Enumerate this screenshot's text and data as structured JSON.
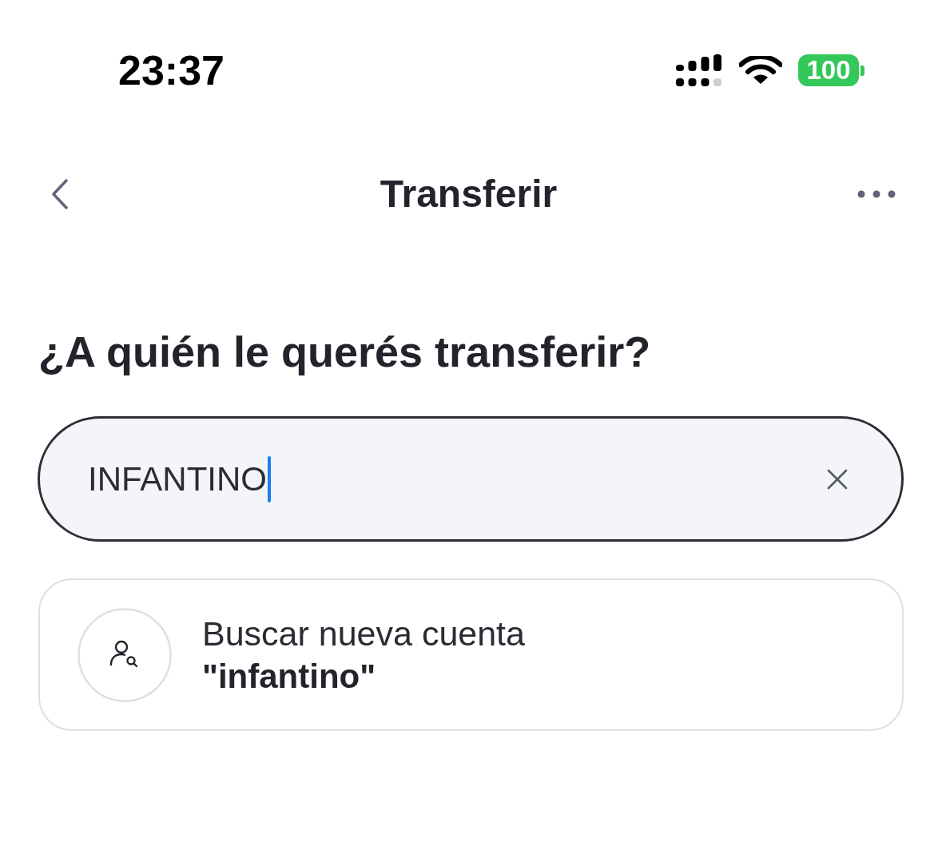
{
  "status_bar": {
    "time": "23:37",
    "battery": "100"
  },
  "nav": {
    "title": "Transferir"
  },
  "heading": "¿A quién le querés transferir?",
  "search": {
    "value": "INFANTINO",
    "focused": true
  },
  "results": [
    {
      "kind": "new-account",
      "label": "Buscar nueva cuenta",
      "query": "\"infantino\""
    }
  ]
}
